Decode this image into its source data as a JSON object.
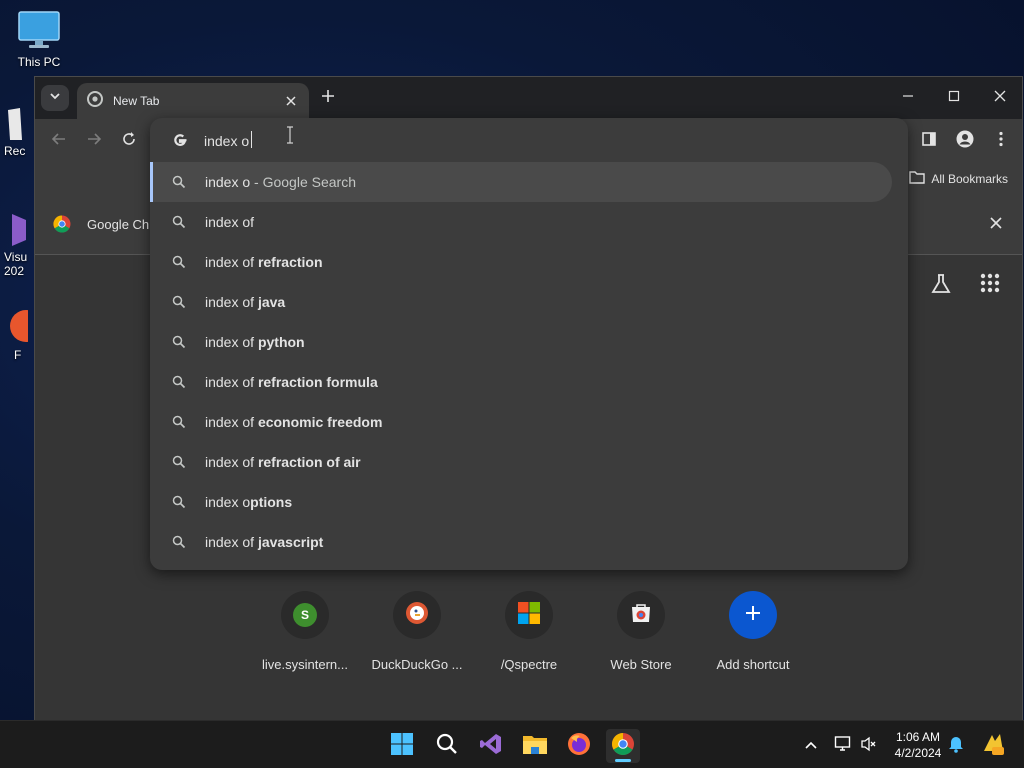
{
  "desktop": {
    "icons": [
      {
        "label": "This PC"
      },
      {
        "label": "Rec"
      },
      {
        "label": "Visu\n202"
      },
      {
        "label": "F"
      }
    ]
  },
  "browser": {
    "tab": {
      "title": "New Tab"
    },
    "bookmarks": {
      "all_label": "All Bookmarks"
    },
    "infobar": {
      "label": "Google Ch"
    },
    "omnibox": {
      "value": "index o",
      "suggestions": [
        {
          "typed": "index o",
          "completion": "",
          "suffix": " - Google Search",
          "selected": true
        },
        {
          "typed": "index of",
          "completion": "",
          "suffix": ""
        },
        {
          "typed": "index of ",
          "completion": "refraction",
          "suffix": ""
        },
        {
          "typed": "index of ",
          "completion": "java",
          "suffix": ""
        },
        {
          "typed": "index of ",
          "completion": "python",
          "suffix": ""
        },
        {
          "typed": "index of ",
          "completion": "refraction formula",
          "suffix": ""
        },
        {
          "typed": "index of ",
          "completion": "economic freedom",
          "suffix": ""
        },
        {
          "typed": "index of ",
          "completion": "refraction of air",
          "suffix": ""
        },
        {
          "typed": "index o",
          "completion": "ptions",
          "suffix": ""
        },
        {
          "typed": "index of ",
          "completion": "javascript",
          "suffix": ""
        }
      ]
    },
    "shortcuts": [
      {
        "label": "live.sysintern...",
        "icon": "s-letter-icon",
        "letter": "S"
      },
      {
        "label": "DuckDuckGo ...",
        "icon": "duckduckgo-icon"
      },
      {
        "label": "/Qspectre",
        "icon": "microsoft-icon"
      },
      {
        "label": "Web Store",
        "icon": "web-store-icon"
      },
      {
        "label": "Add shortcut",
        "icon": "plus-icon"
      }
    ]
  },
  "taskbar": {
    "clock": {
      "time": "1:06 AM",
      "date": "4/2/2024"
    },
    "apps": [
      "start-icon",
      "search-icon",
      "visual-studio-icon",
      "file-explorer-icon",
      "firefox-icon",
      "chrome-icon"
    ]
  },
  "colors": {
    "accent": "#a8c7fa",
    "taskbar_active": "#60cdff",
    "add_shortcut": "#0b57d0"
  }
}
